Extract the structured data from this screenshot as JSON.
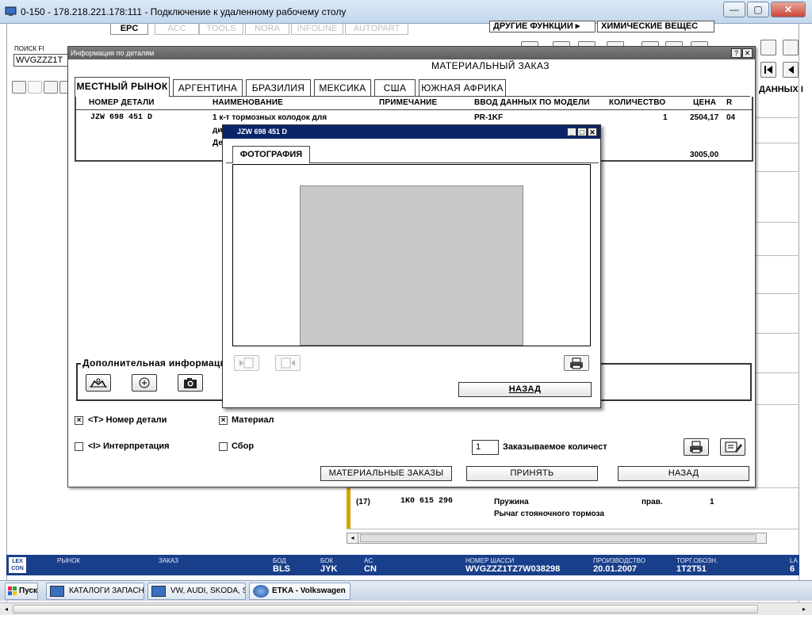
{
  "window": {
    "title": "0-150 - 178.218.221.178:111 - Подключение к удаленному рабочему столу",
    "min_label": "—",
    "max_label": "▢",
    "close_label": "✕"
  },
  "app_tabs": [
    "EPC",
    "ACC",
    "TOOLS",
    "NORA",
    "INFOLINE",
    "AUTOPART"
  ],
  "menus": {
    "other_functions": "ДРУГИЕ ФУНКЦИИ ▸",
    "chemicals": "ХИМИЧЕСКИЕ ВЕЩЕС"
  },
  "search": {
    "label": "ПОИСК FI",
    "value": "WVGZZZ1T"
  },
  "right_edge_header": "ДАННЫХ I",
  "dialog": {
    "bar_title": "Информация по деталям",
    "heading": "МАТЕРИАЛЬНЫЙ ЗАКАЗ",
    "help_label": "?",
    "close_label": "✕",
    "tabs": [
      "МЕСТНЫЙ РЫНОК",
      "АРГЕНТИНА",
      "БРАЗИЛИЯ",
      "МЕКСИКА",
      "США",
      "ЮЖНАЯ АФРИКА"
    ],
    "columns": [
      "НОМЕР ДЕТАЛИ",
      "НАИМЕНОВАНИЕ",
      "ПРИМЕЧАНИЕ",
      "ВВОД ДАННЫХ ПО МОДЕЛИ",
      "КОЛИЧЕСТВО",
      "ЦЕНА",
      "R"
    ],
    "row": {
      "part_no": "JZW 698 451 D",
      "name": "1 к-т тормозных колодок для",
      "name_line2": "ди",
      "name_line3": "Де",
      "model": "PR-1KF",
      "qty": "1",
      "price": "2504,17",
      "r": "04",
      "total": "3005,00"
    },
    "extra_info_label": "Дополнительная информация",
    "checks": {
      "part_number": "<T> Номер детали",
      "material": "Материал",
      "interpretation": "<I> Интерпретация",
      "assembly": "Сбор"
    },
    "order_qty_value": "1",
    "order_qty_label": "Заказываемое количест",
    "buttons": {
      "material_orders": "МАТЕРИАЛЬНЫЕ ЗАКАЗЫ",
      "accept": "ПРИНЯТЬ",
      "back": "НАЗАД"
    }
  },
  "photo": {
    "title": "JZW 698 451 D",
    "tab": "ФОТОГРАФИЯ",
    "back_button": "НАЗАД",
    "min_label": "_",
    "max_label": "□",
    "close_label": "✕"
  },
  "bg_list": {
    "item_no": "(17)",
    "part_no": "1K0 615 296",
    "name": "Пружина",
    "side": "прав.",
    "qty": "1",
    "name2": "Рычаг стояночного тормоза"
  },
  "statusbar": {
    "logo": "LEX CON",
    "market_label": "РЫНОК",
    "order_label": "ЗАКАЗ",
    "bod_label": "БОД",
    "bod_value": "BLS",
    "bok_label": "БОК",
    "bok_value": "JYK",
    "ac_label": "AC",
    "ac_value": "CN",
    "chassis_label": "НОМЕР ШАССИ",
    "chassis_value": "WVGZZZ1TZ7W038298",
    "production_label": "ПРОИЗВОДСТВО",
    "production_value": "20.01.2007",
    "trade_label": "ТОРГ.ОБОЗН.",
    "trade_value": "1T2T51",
    "edge_label": "LA",
    "edge_value": "6"
  },
  "taskbar": {
    "start": "Пуск",
    "tasks": [
      "КАТАЛОГИ ЗАПАСН...",
      "VW, AUDI, SKODA, S...",
      "ETKA - Volkswagen"
    ]
  },
  "colors": {
    "statusbar": "#1a3f8a",
    "photo_titlebar": "#0a246a",
    "accent_yellow": "#d6a300"
  }
}
